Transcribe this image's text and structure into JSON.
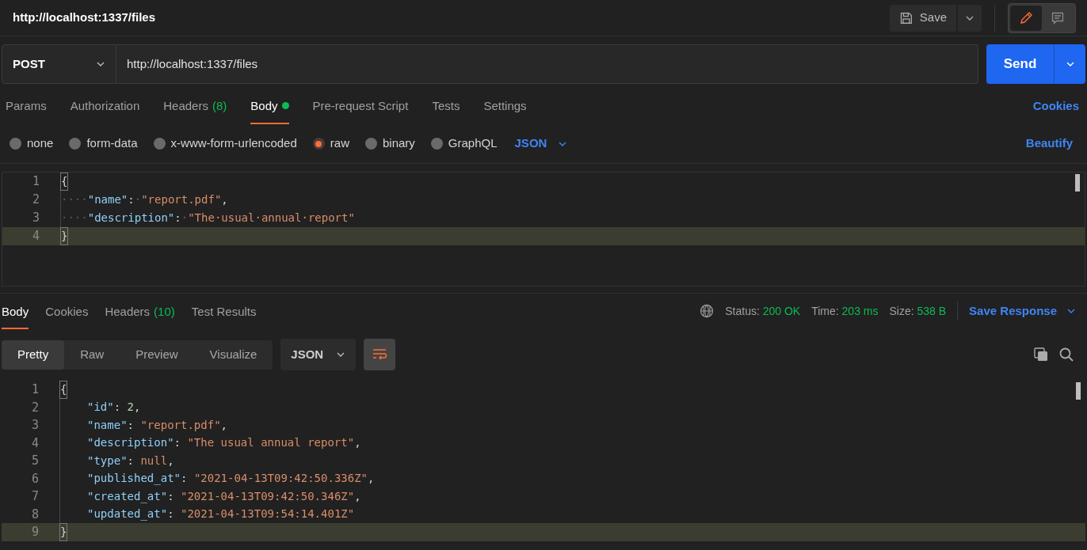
{
  "header": {
    "title": "http://localhost:1337/files",
    "save_label": "Save",
    "modes": [
      {
        "kind": "edit",
        "selected": true
      },
      {
        "kind": "comment",
        "selected": false
      }
    ]
  },
  "request": {
    "method": "POST",
    "url": "http://localhost:1337/files",
    "send_label": "Send"
  },
  "request_tabs": [
    {
      "label": "Params",
      "selected": false
    },
    {
      "label": "Authorization",
      "selected": false
    },
    {
      "label": "Headers",
      "count": "(8)",
      "selected": false
    },
    {
      "label": "Body",
      "dot": true,
      "selected": true
    },
    {
      "label": "Pre-request Script",
      "selected": false
    },
    {
      "label": "Tests",
      "selected": false
    },
    {
      "label": "Settings",
      "selected": false
    }
  ],
  "cookies_link": "Cookies",
  "body_types": [
    {
      "label": "none",
      "selected": false
    },
    {
      "label": "form-data",
      "selected": false
    },
    {
      "label": "x-www-form-urlencoded",
      "selected": false
    },
    {
      "label": "raw",
      "selected": true
    },
    {
      "label": "binary",
      "selected": false
    },
    {
      "label": "GraphQL",
      "selected": false
    }
  ],
  "body_format": "JSON",
  "beautify_link": "Beautify",
  "request_editor": {
    "lines": [
      {
        "number": "1",
        "current": false,
        "tokens": [
          {
            "kind": "brace",
            "text": "{"
          }
        ]
      },
      {
        "number": "2",
        "current": false,
        "tokens": [
          {
            "kind": "ws",
            "text": "····"
          },
          {
            "kind": "key",
            "text": "\"name\""
          },
          {
            "kind": "punct",
            "text": ":"
          },
          {
            "kind": "ws",
            "text": "·"
          },
          {
            "kind": "string",
            "text": "\"report.pdf\""
          },
          {
            "kind": "punct",
            "text": ","
          }
        ]
      },
      {
        "number": "3",
        "current": false,
        "tokens": [
          {
            "kind": "ws",
            "text": "····"
          },
          {
            "kind": "key",
            "text": "\"description\""
          },
          {
            "kind": "punct",
            "text": ":"
          },
          {
            "kind": "ws",
            "text": "·"
          },
          {
            "kind": "string",
            "text": "\"The·usual·annual·report\""
          }
        ]
      },
      {
        "number": "4",
        "current": true,
        "tokens": [
          {
            "kind": "brace",
            "text": "}"
          }
        ]
      }
    ]
  },
  "response_tabs": [
    {
      "label": "Body",
      "selected": true
    },
    {
      "label": "Cookies",
      "selected": false
    },
    {
      "label": "Headers",
      "count": "(10)",
      "selected": false
    },
    {
      "label": "Test Results",
      "selected": false
    }
  ],
  "response_meta": {
    "status_label": "Status:",
    "status": "200 OK",
    "time_label": "Time:",
    "time": "203 ms",
    "size_label": "Size:",
    "size": "538 B",
    "save_response": "Save Response"
  },
  "view_modes": [
    {
      "label": "Pretty",
      "selected": true
    },
    {
      "label": "Raw",
      "selected": false
    },
    {
      "label": "Preview",
      "selected": false
    },
    {
      "label": "Visualize",
      "selected": false
    }
  ],
  "response_format": "JSON",
  "response_editor": {
    "lines": [
      {
        "number": "1",
        "current": false,
        "tokens": [
          {
            "kind": "brace",
            "text": "{"
          }
        ]
      },
      {
        "number": "2",
        "current": false,
        "indent": true,
        "tokens": [
          {
            "kind": "key",
            "text": "\"id\""
          },
          {
            "kind": "punct",
            "text": ": "
          },
          {
            "kind": "number",
            "text": "2"
          },
          {
            "kind": "punct",
            "text": ","
          }
        ]
      },
      {
        "number": "3",
        "current": false,
        "indent": true,
        "tokens": [
          {
            "kind": "key",
            "text": "\"name\""
          },
          {
            "kind": "punct",
            "text": ": "
          },
          {
            "kind": "string",
            "text": "\"report.pdf\""
          },
          {
            "kind": "punct",
            "text": ","
          }
        ]
      },
      {
        "number": "4",
        "current": false,
        "indent": true,
        "tokens": [
          {
            "kind": "key",
            "text": "\"description\""
          },
          {
            "kind": "punct",
            "text": ": "
          },
          {
            "kind": "string",
            "text": "\"The usual annual report\""
          },
          {
            "kind": "punct",
            "text": ","
          }
        ]
      },
      {
        "number": "5",
        "current": false,
        "indent": true,
        "tokens": [
          {
            "kind": "key",
            "text": "\"type\""
          },
          {
            "kind": "punct",
            "text": ": "
          },
          {
            "kind": "null",
            "text": "null"
          },
          {
            "kind": "punct",
            "text": ","
          }
        ]
      },
      {
        "number": "6",
        "current": false,
        "indent": true,
        "tokens": [
          {
            "kind": "key",
            "text": "\"published_at\""
          },
          {
            "kind": "punct",
            "text": ": "
          },
          {
            "kind": "string",
            "text": "\"2021-04-13T09:42:50.336Z\""
          },
          {
            "kind": "punct",
            "text": ","
          }
        ]
      },
      {
        "number": "7",
        "current": false,
        "indent": true,
        "tokens": [
          {
            "kind": "key",
            "text": "\"created_at\""
          },
          {
            "kind": "punct",
            "text": ": "
          },
          {
            "kind": "string",
            "text": "\"2021-04-13T09:42:50.346Z\""
          },
          {
            "kind": "punct",
            "text": ","
          }
        ]
      },
      {
        "number": "8",
        "current": false,
        "indent": true,
        "tokens": [
          {
            "kind": "key",
            "text": "\"updated_at\""
          },
          {
            "kind": "punct",
            "text": ": "
          },
          {
            "kind": "string",
            "text": "\"2021-04-13T09:54:14.401Z\""
          }
        ]
      },
      {
        "number": "9",
        "current": true,
        "tokens": [
          {
            "kind": "brace",
            "text": "}"
          }
        ]
      }
    ]
  }
}
